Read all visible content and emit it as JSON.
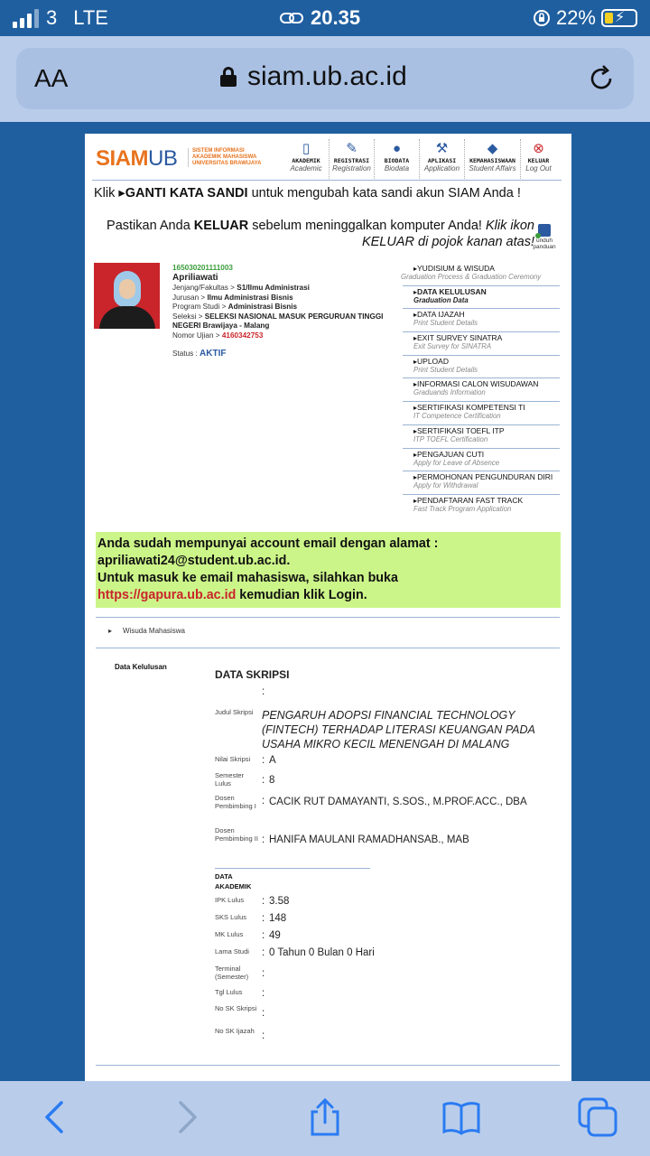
{
  "status_bar": {
    "carrier": "3",
    "network": "LTE",
    "time": "20.35",
    "battery": "22%"
  },
  "browser": {
    "text_size_label": "AA",
    "url": "siam.ub.ac.id"
  },
  "header": {
    "logo_main": "SIAM",
    "logo_ub": "UB",
    "logo_subtitle": [
      "SISTEM INFORMASI",
      "AKADEMIK MAHASISWA",
      "UNIVERSITAS BRAWIJAYA"
    ],
    "nav": [
      {
        "label": "AKADEMIK",
        "sub": "Academic",
        "icon": "book-icon"
      },
      {
        "label": "REGISTRASI",
        "sub": "Registration",
        "icon": "pen-icon"
      },
      {
        "label": "BIODATA",
        "sub": "Biodata",
        "icon": "person-icon"
      },
      {
        "label": "APLIKASI",
        "sub": "Application",
        "icon": "wrench-icon"
      },
      {
        "label": "KEMAHASISWAAN",
        "sub": "Student Affairs",
        "icon": "graduation-cap-icon"
      },
      {
        "label": "KELUAR",
        "sub": "Log Out",
        "icon": "close-icon"
      }
    ]
  },
  "notice": {
    "line1_prefix": "Klik ",
    "line1_link": "GANTI KATA SANDI",
    "line1_suffix": " untuk mengubah kata sandi akun SIAM Anda !",
    "line2_prefix": "Pastikan Anda ",
    "line2_bold": "KELUAR",
    "line2_suffix": " sebelum meninggalkan komputer Anda! ",
    "line2_italic": "Klik ikon KELUAR di pojok kanan atas!",
    "panduan": "unduh panduan"
  },
  "student": {
    "nim": "165030201111003",
    "name": "Apriliawati",
    "fakultas_label": "Jenjang/Fakultas > ",
    "fakultas": "S1/Ilmu Administrasi",
    "jurusan_label": "Jurusan > ",
    "jurusan": "Ilmu Administrasi Bisnis",
    "prodi_label": "Program Studi > ",
    "prodi": "Administrasi Bisnis",
    "seleksi_label": "Seleksi > ",
    "seleksi": "SELEKSI NASIONAL MASUK PERGURUAN TINGGI NEGERI Brawijaya - Malang",
    "ujian_label": "Nomor Ujian > ",
    "ujian": "4160342753",
    "status_label": "Status : ",
    "status": "AKTIF"
  },
  "side_menu": [
    {
      "title": "YUDISIUM & WISUDA",
      "sub": "Graduation Process & Graduation Ceremony"
    },
    {
      "title": "DATA KELULUSAN",
      "sub": "Graduation Data"
    },
    {
      "title": "DATA IJAZAH",
      "sub": "Print Student Details"
    },
    {
      "title": "EXIT SURVEY SINATRA",
      "sub": "Exit Survey for SINATRA"
    },
    {
      "title": "UPLOAD",
      "sub": "Print Student Details"
    },
    {
      "title": "INFORMASI CALON WISUDAWAN",
      "sub": "Graduands Information"
    },
    {
      "title": "SERTIFIKASI KOMPETENSI TI",
      "sub": "IT Competence Certification"
    },
    {
      "title": "SERTIFIKASI TOEFL ITP",
      "sub": "ITP TOEFL Certification"
    },
    {
      "title": "PENGAJUAN CUTI",
      "sub": "Apply for Leave of Absence"
    },
    {
      "title": "PERMOHONAN PENGUNDURAN DIRI",
      "sub": "Apply for Withdrawal"
    },
    {
      "title": "PENDAFTARAN FAST TRACK",
      "sub": "Fast Track Program Application"
    }
  ],
  "email_box": {
    "line1": "Anda sudah mempunyai account email dengan alamat :",
    "line2": "apriliawati24@student.ub.ac.id.",
    "line3": "Untuk masuk ke email mahasiswa, silahkan buka",
    "link": "https://gapura.ub.ac.id",
    "line4_suffix": " kemudian klik Login."
  },
  "breadcrumb": {
    "item": "Wisuda Mahasiswa"
  },
  "kelulusan": {
    "side_label": "Data Kelulusan",
    "title": "DATA SKRIPSI",
    "judul_label": "Judul Skripsi",
    "judul": "PENGARUH ADOPSI FINANCIAL TECHNOLOGY (FINTECH) TERHADAP LITERASI KEUANGAN PADA USAHA MIKRO KECIL MENENGAH DI MALANG",
    "nilai_label": "Nilai Skripsi",
    "nilai": "A",
    "semester_label": "Semester Lulus",
    "semester": "8",
    "dosen1_label": "Dosen Pembimbing I",
    "dosen1": "CACIK RUT DAMAYANTI, S.SOS., M.PROF.ACC., DBA",
    "dosen2_label": "Dosen Pembimbing II",
    "dosen2": "HANIFA MAULANI RAMADHANSAB., MAB",
    "akademik_title": "DATA AKADEMIK",
    "ipk_label": "IPK Lulus",
    "ipk": "3.58",
    "sks_label": "SKS Lulus",
    "sks": "148",
    "mk_label": "MK Lulus",
    "mk": "49",
    "lama_label": "Lama Studi",
    "lama": "0 Tahun 0 Bulan 0 Hari",
    "terminal_label": "Terminal (Semester)",
    "tgl_label": "Tgl Lulus",
    "nosk_skripsi_label": "No SK Skripsi",
    "nosk_ijazah_label": "No SK Ijazah",
    "colon": ":"
  }
}
